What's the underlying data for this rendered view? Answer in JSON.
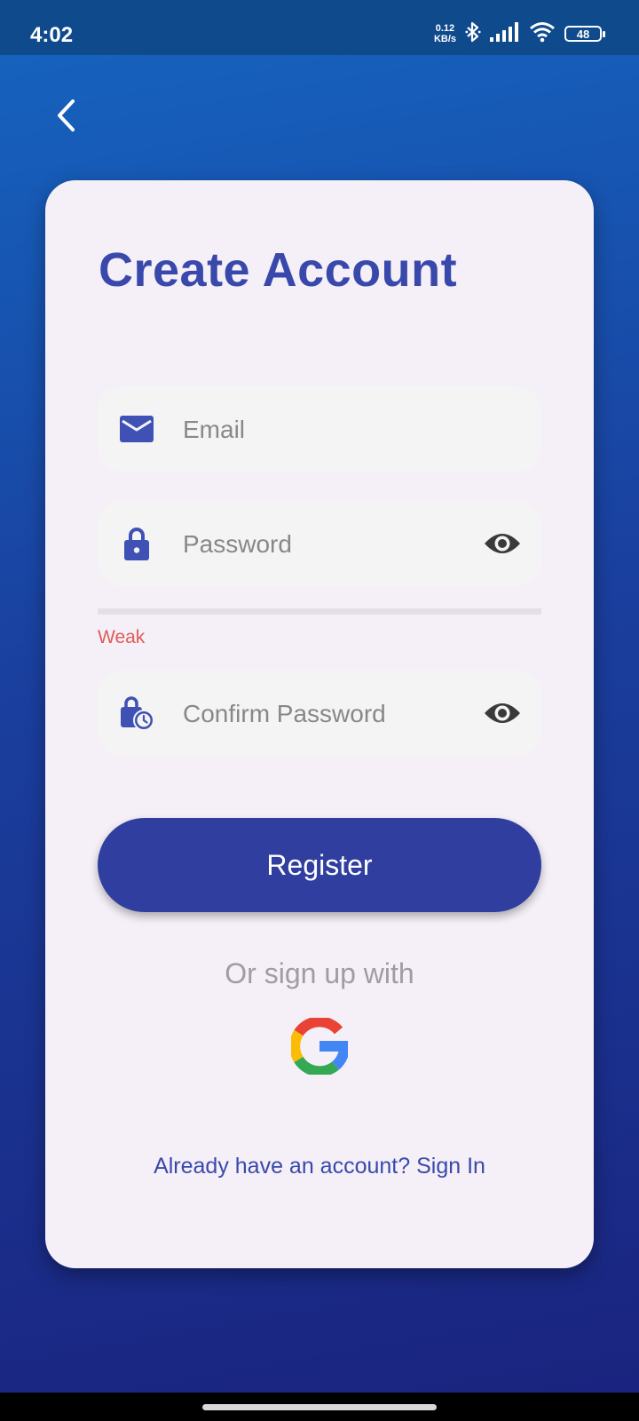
{
  "status_bar": {
    "time": "4:02",
    "net_speed_value": "0.12",
    "net_speed_unit": "KB/s",
    "battery": "48"
  },
  "page": {
    "title": "Create Account"
  },
  "form": {
    "email_placeholder": "Email",
    "password_placeholder": "Password",
    "password_strength": "Weak",
    "confirm_placeholder": "Confirm Password"
  },
  "actions": {
    "register_label": "Register",
    "or_text": "Or sign up with",
    "signin_text": "Already have an account? Sign In"
  },
  "colors": {
    "accent": "#3949ab",
    "button": "#303f9f",
    "weak": "#e05a55",
    "card": "#f5f0f8"
  },
  "icons": {
    "back": "chevron-left-icon",
    "email": "mail-icon",
    "password": "lock-icon",
    "confirm": "lock-clock-icon",
    "visibility": "eye-icon",
    "social": "google-icon"
  }
}
